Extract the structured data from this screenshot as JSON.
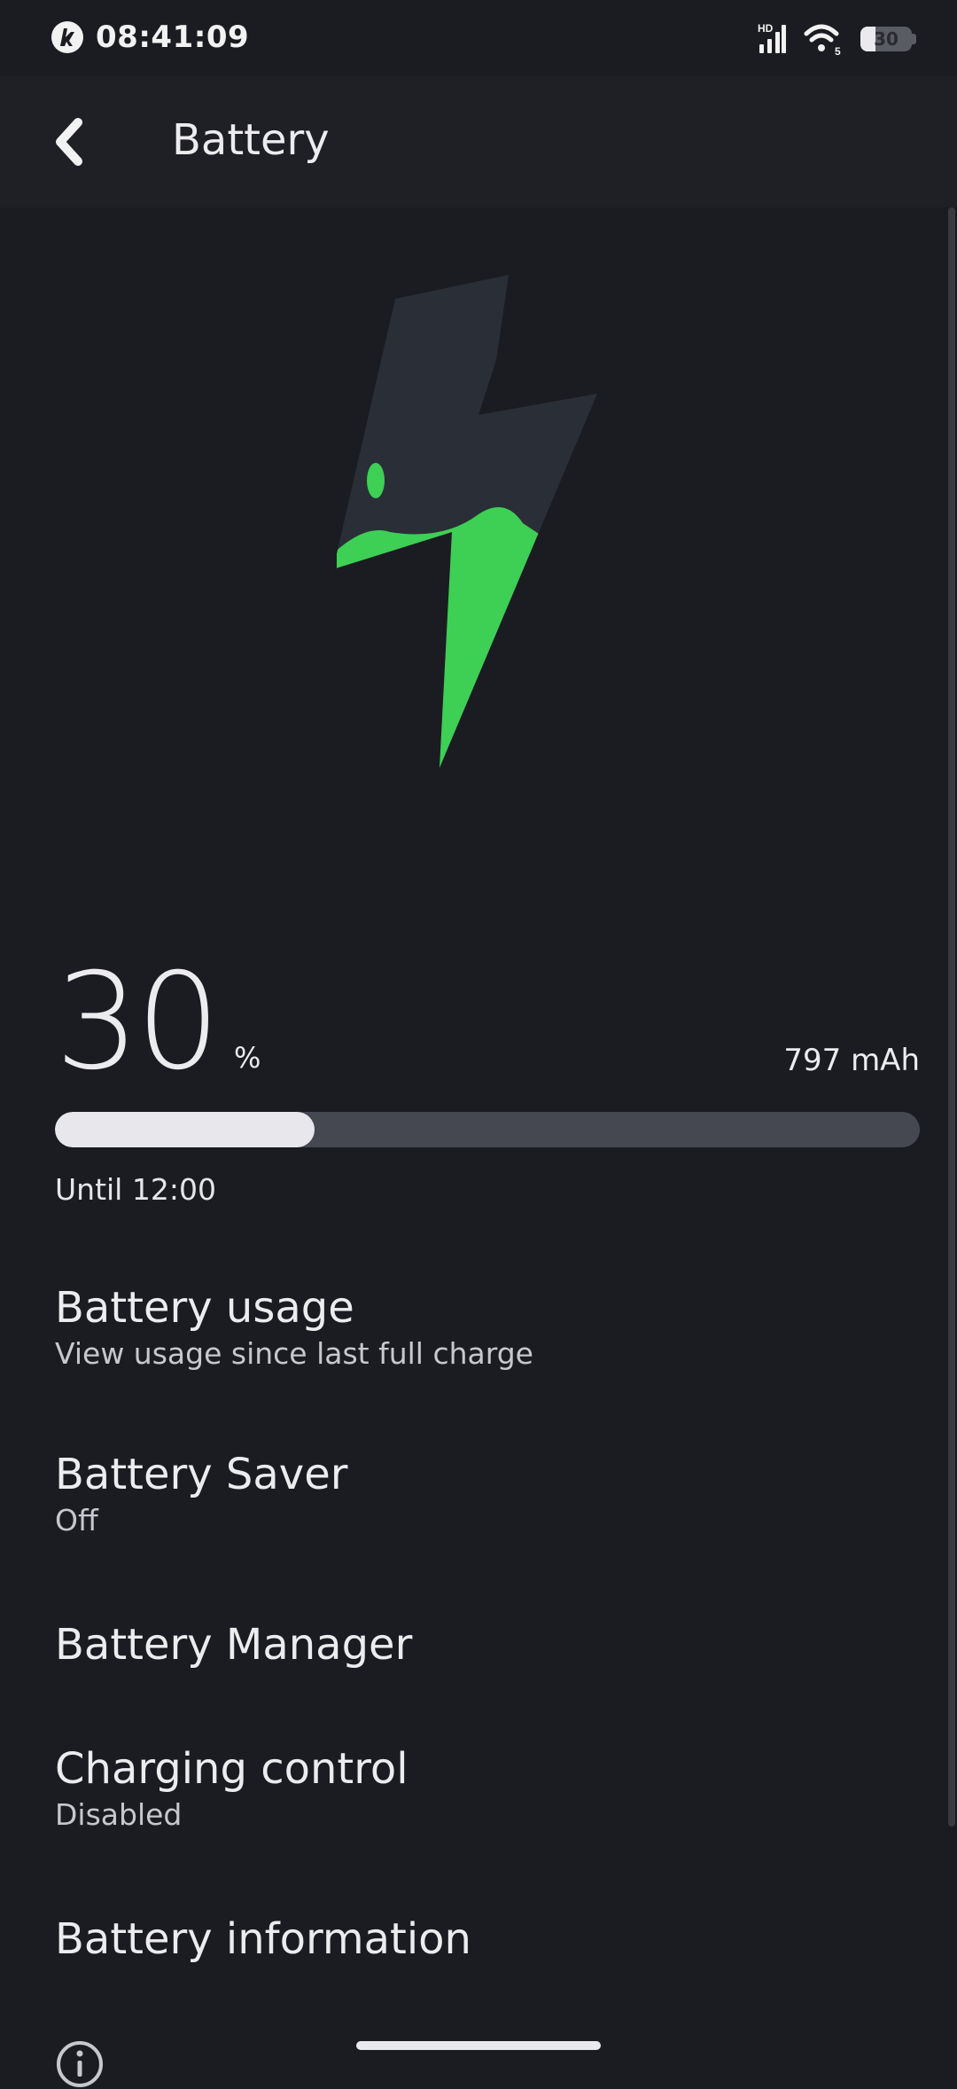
{
  "status_bar": {
    "time": "08:41:09",
    "network_badge": "HD",
    "wifi_badge": "5",
    "battery_percent_text": "30",
    "battery_level": 0.3,
    "icons": [
      "app-logo-icon",
      "signal-icon",
      "wifi-icon",
      "battery-icon"
    ]
  },
  "app_bar": {
    "title": "Battery",
    "back_icon": "back-chevron-icon"
  },
  "battery": {
    "percent_value": "30",
    "percent_sign": "%",
    "capacity": "797 mAh",
    "level": 0.3,
    "until": "Until 12:00",
    "hero_icon": "charging-bolt-icon",
    "accent_color": "#3ecf55"
  },
  "preferences": [
    {
      "title": "Battery usage",
      "summary": "View usage since last full charge"
    },
    {
      "title": "Battery Saver",
      "summary": "Off"
    },
    {
      "title": "Battery Manager",
      "summary": ""
    },
    {
      "title": "Charging control",
      "summary": "Disabled"
    },
    {
      "title": "Battery information",
      "summary": ""
    }
  ],
  "footer": {
    "icon": "info-icon"
  }
}
